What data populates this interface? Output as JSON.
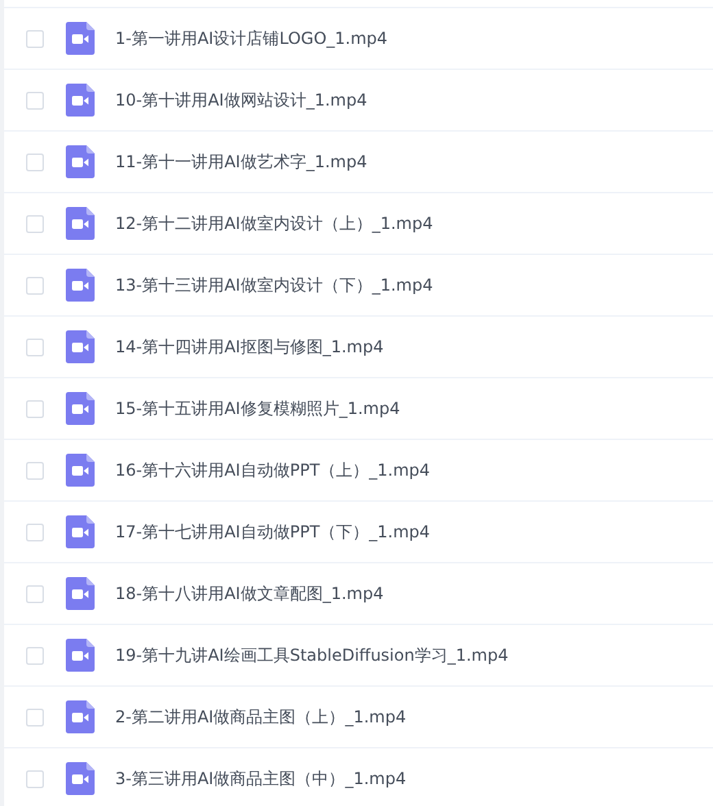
{
  "files": [
    {
      "name": "1-第一讲用AI设计店铺LOGO_1.mp4",
      "checked": false
    },
    {
      "name": "10-第十讲用AI做网站设计_1.mp4",
      "checked": false
    },
    {
      "name": "11-第十一讲用AI做艺术字_1.mp4",
      "checked": false
    },
    {
      "name": "12-第十二讲用AI做室内设计（上）_1.mp4",
      "checked": false
    },
    {
      "name": "13-第十三讲用AI做室内设计（下）_1.mp4",
      "checked": false
    },
    {
      "name": "14-第十四讲用AI抠图与修图_1.mp4",
      "checked": false
    },
    {
      "name": "15-第十五讲用AI修复模糊照片_1.mp4",
      "checked": false
    },
    {
      "name": "16-第十六讲用AI自动做PPT（上）_1.mp4",
      "checked": false
    },
    {
      "name": "17-第十七讲用AI自动做PPT（下）_1.mp4",
      "checked": false
    },
    {
      "name": "18-第十八讲用AI做文章配图_1.mp4",
      "checked": false
    },
    {
      "name": "19-第十九讲AI绘画工具StableDiffusion学习_1.mp4",
      "checked": false
    },
    {
      "name": "2-第二讲用AI做商品主图（上）_1.mp4",
      "checked": false
    },
    {
      "name": "3-第三讲用AI做商品主图（中）_1.mp4",
      "checked": false
    }
  ]
}
